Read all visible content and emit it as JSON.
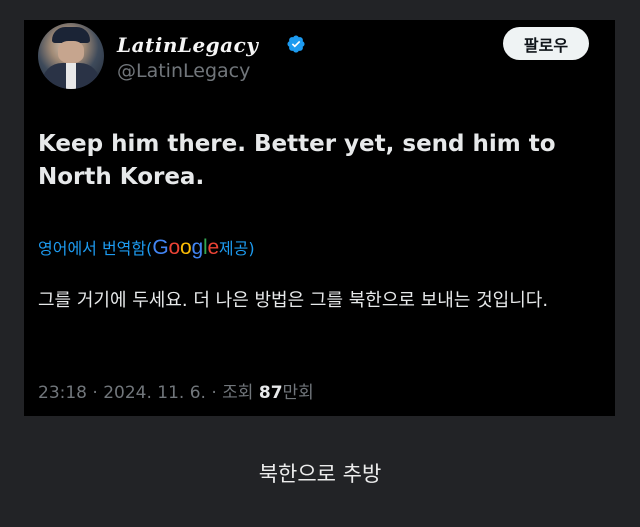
{
  "tweet": {
    "display_name": "LatinLegacy",
    "handle": "@LatinLegacy",
    "follow_label": "팔로우",
    "text": "Keep him there. Better yet, send him to North Korea.",
    "translate_label": "영어에서 번역함(",
    "translate_provider_parts": [
      "G",
      "o",
      "o",
      "g",
      "l",
      "e"
    ],
    "translate_suffix": " 제공)",
    "translated_text": "그를 거기에 두세요. 더 나은 방법은 그를 북한으로 보내는 것입니다.",
    "time": "23:18",
    "date": "2024. 11. 6.",
    "views_label": "조회",
    "views_count": "87",
    "views_unit": "만회",
    "separator": " · ",
    "verified_color": "#1d9bf0"
  },
  "caption": "북한으로 추방"
}
